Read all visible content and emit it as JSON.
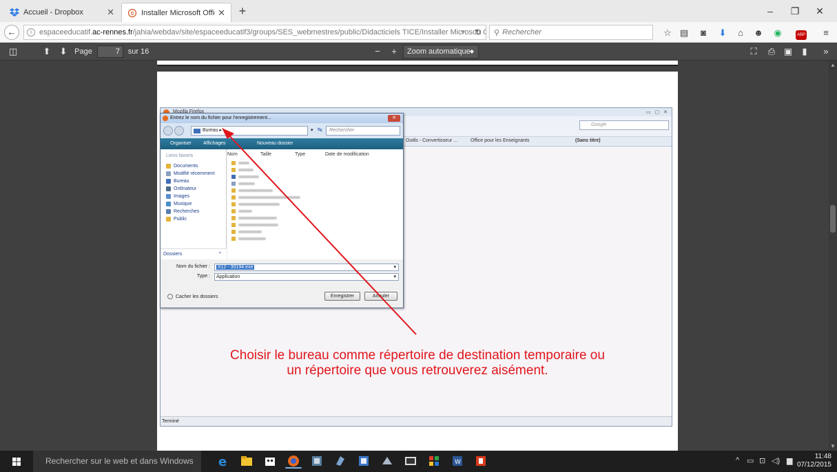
{
  "browser": {
    "tabs": [
      {
        "label": "Accueil - Dropbox",
        "active": false
      },
      {
        "label": "Installer Microsoft Office....",
        "active": true
      }
    ],
    "new_tab_label": "+",
    "window_controls": {
      "minimize": "–",
      "restore": "❐",
      "close": "✕"
    },
    "url": {
      "prefix": "espaceeducatif.",
      "host": "ac-rennes.fr",
      "path": "/jahia/webdav/site/espaceeducatif3/groups/SES_webmestres/public/Didacticiels TICE/Installer Microsoft Office.p"
    },
    "search_placeholder": "Rechercher",
    "toolbar_icons": [
      "star-icon",
      "reading-list-icon",
      "pocket-icon",
      "download-icon",
      "home-icon",
      "chat-icon",
      "extension-icon",
      "abp-icon",
      "menu-icon"
    ]
  },
  "pdf": {
    "page_label": "Page :",
    "page_current": "7",
    "page_total": "sur 16",
    "zoom_minus": "−",
    "zoom_plus": "+",
    "zoom_value": "Zoom automatique"
  },
  "embedded": {
    "window_title": "Mozilla Firefox",
    "google_placeholder": "Google",
    "tabs": [
      "Outils - Convertisseur ...",
      "Office pour les Enseignants",
      "(Sans titre)"
    ],
    "status": "Terminé",
    "dialog": {
      "title": "Entrez le nom du fichier pour l'enregistrement...",
      "location": "Bureau",
      "search_placeholder": "Rechercher",
      "organize": "Organiser",
      "views": "Affichages",
      "new_folder": "Nouveau dossier",
      "favorites_header": "Liens favoris",
      "favorites": [
        "Documents",
        "Modifié récemment",
        "Bureau",
        "Ordinateur",
        "Images",
        "Musique",
        "Recherches",
        "Public"
      ],
      "folders_label": "Dossiers",
      "columns": [
        "Nom",
        "Taille",
        "Type",
        "Date de modification"
      ],
      "filename_label": "Nom du fichier :",
      "filename_value": "X12 - 30194.exe",
      "type_label": "Type :",
      "type_value": "Application",
      "hide_folders": "Cacher les dossiers",
      "save_button": "Enregistrer",
      "cancel_button": "Annuler"
    }
  },
  "annotation": {
    "line1": "Choisir le bureau comme répertoire de destination temporaire ou",
    "line2": "un répertoire que vous retrouverez aisément."
  },
  "taskbar": {
    "search_text": "Rechercher sur le web et dans Windows",
    "time": "11:48",
    "date": "07/12/2015"
  },
  "colors": {
    "annotation_red": "#e1151c",
    "pdf_background": "#404040",
    "taskbar": "#1e1e1e"
  }
}
